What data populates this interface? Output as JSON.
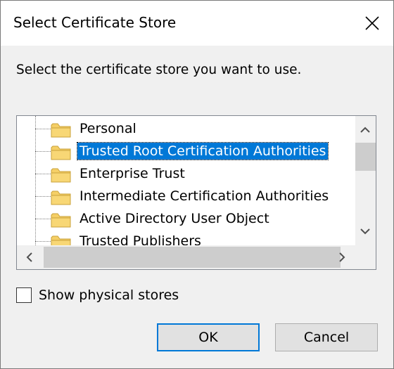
{
  "window": {
    "title": "Select Certificate Store",
    "close_icon": "close-icon"
  },
  "prompt": "Select the certificate store you want to use.",
  "tree": {
    "items": [
      {
        "label": "Personal",
        "selected": false
      },
      {
        "label": "Trusted Root Certification Authorities",
        "selected": true
      },
      {
        "label": "Enterprise Trust",
        "selected": false
      },
      {
        "label": "Intermediate Certification Authorities",
        "selected": false
      },
      {
        "label": "Active Directory User Object",
        "selected": false
      },
      {
        "label": "Trusted Publishers",
        "selected": false
      }
    ],
    "folder_color": "#f5cf66"
  },
  "checkbox": {
    "label": "Show physical stores",
    "checked": false
  },
  "buttons": {
    "ok": "OK",
    "cancel": "Cancel"
  },
  "colors": {
    "selection": "#0078d7",
    "default_button_border": "#0078d7"
  }
}
